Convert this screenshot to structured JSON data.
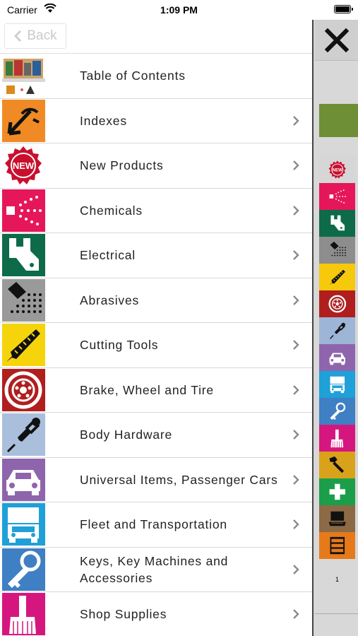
{
  "status_bar": {
    "carrier": "Carrier",
    "time": "1:09 PM"
  },
  "nav": {
    "back_label": "Back"
  },
  "menu": [
    {
      "label": "Table of Contents",
      "icon": "catalog-cover-icon",
      "color": "#ffffff",
      "chevron": false
    },
    {
      "label": "Indexes",
      "icon": "index-arrow-icon",
      "color": "#f08a24",
      "chevron": true
    },
    {
      "label": "New Products",
      "icon": "new-badge-icon",
      "color": "#ffffff",
      "chevron": true
    },
    {
      "label": "Chemicals",
      "icon": "spray-icon",
      "color": "#e5175a",
      "chevron": true
    },
    {
      "label": "Electrical",
      "icon": "connector-icon",
      "color": "#0d6b4a",
      "chevron": true
    },
    {
      "label": "Abrasives",
      "icon": "sanding-icon",
      "color": "#9a9a9a",
      "chevron": true
    },
    {
      "label": "Cutting Tools",
      "icon": "saw-icon",
      "color": "#f6d40c",
      "chevron": true
    },
    {
      "label": "Brake, Wheel and Tire",
      "icon": "wheel-icon",
      "color": "#b01e1e",
      "chevron": true
    },
    {
      "label": "Body Hardware",
      "icon": "fastener-icon",
      "color": "#a9bfdc",
      "chevron": true
    },
    {
      "label": "Universal Items, Passenger Cars",
      "icon": "car-icon",
      "color": "#8e65ad",
      "chevron": true
    },
    {
      "label": "Fleet and Transportation",
      "icon": "truck-icon",
      "color": "#1fa0d8",
      "chevron": true
    },
    {
      "label": "Keys, Key Machines and Accessories",
      "icon": "key-icon",
      "color": "#3f7fc4",
      "chevron": true
    },
    {
      "label": "Shop Supplies",
      "icon": "broom-icon",
      "color": "#d6167f",
      "chevron": true
    }
  ],
  "side_index": {
    "close_icon": "close-icon",
    "active_color": "#6e8f35",
    "items": [
      {
        "icon": "new-badge-icon",
        "color": "#d6d6d6"
      },
      {
        "icon": "spray-icon",
        "color": "#e5175a"
      },
      {
        "icon": "connector-icon",
        "color": "#0d6b4a"
      },
      {
        "icon": "sanding-icon",
        "color": "#8d8d8d"
      },
      {
        "icon": "saw-icon",
        "color": "#f6c90c"
      },
      {
        "icon": "wheel-icon",
        "color": "#b01e1e"
      },
      {
        "icon": "fastener-icon",
        "color": "#9db5d6"
      },
      {
        "icon": "car-icon",
        "color": "#8e65ad"
      },
      {
        "icon": "truck-icon",
        "color": "#1fa0d8"
      },
      {
        "icon": "key-icon",
        "color": "#3f7fc4"
      },
      {
        "icon": "broom-icon",
        "color": "#d6167f"
      },
      {
        "icon": "bolt-icon",
        "color": "#d9a21b"
      },
      {
        "icon": "first-aid-icon",
        "color": "#1b9e4a"
      },
      {
        "icon": "laptop-icon",
        "color": "#8c6a45"
      },
      {
        "icon": "cabinet-icon",
        "color": "#e67a1a"
      }
    ],
    "page_number": "1"
  }
}
